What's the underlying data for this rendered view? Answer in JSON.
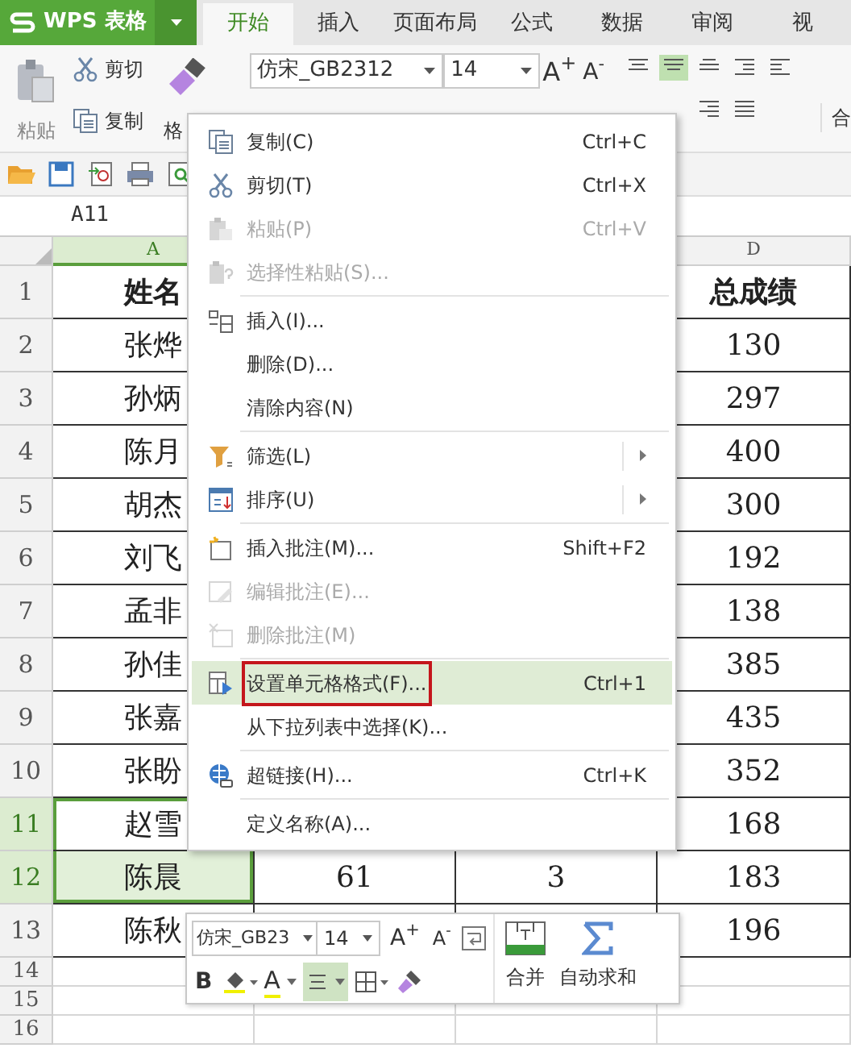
{
  "app": {
    "title": "WPS 表格"
  },
  "tabs": [
    {
      "label": "开始",
      "selected": true
    },
    {
      "label": "插入",
      "selected": false
    },
    {
      "label": "页面布局",
      "selected": false
    },
    {
      "label": "公式",
      "selected": false
    },
    {
      "label": "数据",
      "selected": false
    },
    {
      "label": "审阅",
      "selected": false
    },
    {
      "label": "视",
      "selected": false
    }
  ],
  "ribbon": {
    "paste": "粘贴",
    "cut": "剪切",
    "copy": "复制",
    "format_painter": "格",
    "font": "仿宋_GB2312",
    "size": "14",
    "grow": "A$^{+}$",
    "shrink": "A$^{-}$",
    "merge": "合"
  },
  "name_box": "A11",
  "columns": [
    {
      "label": "A",
      "selected": true
    },
    {},
    {},
    {
      "label": "D",
      "selected": false
    }
  ],
  "rows": [
    {
      "number": "1",
      "kind": "header",
      "selected": false,
      "active": false,
      "cells": [
        "姓名",
        null,
        null,
        "总成绩"
      ]
    },
    {
      "number": "2",
      "kind": "data",
      "selected": false,
      "active": false,
      "cells": [
        "张烨",
        null,
        null,
        "130"
      ]
    },
    {
      "number": "3",
      "kind": "data",
      "selected": false,
      "active": false,
      "cells": [
        "孙炳",
        null,
        null,
        "297"
      ]
    },
    {
      "number": "4",
      "kind": "data",
      "selected": false,
      "active": false,
      "cells": [
        "陈月",
        null,
        null,
        "400"
      ]
    },
    {
      "number": "5",
      "kind": "data",
      "selected": false,
      "active": false,
      "cells": [
        "胡杰",
        null,
        null,
        "300"
      ]
    },
    {
      "number": "6",
      "kind": "data",
      "selected": false,
      "active": false,
      "cells": [
        "刘飞",
        null,
        null,
        "192"
      ]
    },
    {
      "number": "7",
      "kind": "data",
      "selected": false,
      "active": false,
      "cells": [
        "孟非",
        null,
        null,
        "138"
      ]
    },
    {
      "number": "8",
      "kind": "data",
      "selected": false,
      "active": false,
      "cells": [
        "孙佳",
        null,
        null,
        "385"
      ]
    },
    {
      "number": "9",
      "kind": "data",
      "selected": false,
      "active": false,
      "cells": [
        "张嘉",
        null,
        null,
        "435"
      ]
    },
    {
      "number": "10",
      "kind": "data",
      "selected": false,
      "active": false,
      "cells": [
        "张盼",
        null,
        null,
        "352"
      ]
    },
    {
      "number": "11",
      "kind": "data",
      "selected": true,
      "active": true,
      "cells": [
        "赵雪",
        null,
        null,
        "168"
      ]
    },
    {
      "number": "12",
      "kind": "data",
      "selected": true,
      "active": false,
      "cells": [
        "陈晨",
        "61",
        "3",
        "183"
      ]
    },
    {
      "number": "13",
      "kind": "data",
      "selected": false,
      "active": false,
      "cells": [
        "陈秋",
        null,
        null,
        "196"
      ]
    },
    {
      "number": "14",
      "kind": "empty",
      "selected": false,
      "active": false,
      "cells": [
        null,
        null,
        null,
        null
      ]
    },
    {
      "number": "15",
      "kind": "empty",
      "selected": false,
      "active": false,
      "cells": [
        null,
        null,
        null,
        null
      ]
    },
    {
      "number": "16",
      "kind": "empty",
      "selected": false,
      "active": false,
      "cells": [
        null,
        null,
        null,
        null
      ]
    }
  ],
  "context_menu": [
    {
      "kind": "item",
      "label": "复制(C)",
      "shortcut": "Ctrl+C",
      "disabled": false,
      "submenu": false,
      "highlighted": false,
      "outlined": false
    },
    {
      "kind": "item",
      "label": "剪切(T)",
      "shortcut": "Ctrl+X",
      "disabled": false,
      "submenu": false,
      "highlighted": false,
      "outlined": false
    },
    {
      "kind": "item",
      "label": "粘贴(P)",
      "shortcut": "Ctrl+V",
      "disabled": true,
      "submenu": false,
      "highlighted": false,
      "outlined": false
    },
    {
      "kind": "item",
      "label": "选择性粘贴(S)...",
      "disabled": true,
      "submenu": false,
      "highlighted": false,
      "outlined": false
    },
    {
      "kind": "separator"
    },
    {
      "kind": "item",
      "label": "插入(I)...",
      "disabled": false,
      "submenu": false,
      "highlighted": false,
      "outlined": false
    },
    {
      "kind": "item",
      "label": "删除(D)...",
      "disabled": false,
      "submenu": false,
      "highlighted": false,
      "outlined": false
    },
    {
      "kind": "item",
      "label": "清除内容(N)",
      "disabled": false,
      "submenu": false,
      "highlighted": false,
      "outlined": false
    },
    {
      "kind": "separator"
    },
    {
      "kind": "item",
      "label": "筛选(L)",
      "disabled": false,
      "submenu": true,
      "highlighted": false,
      "outlined": false
    },
    {
      "kind": "item",
      "label": "排序(U)",
      "disabled": false,
      "submenu": true,
      "highlighted": false,
      "outlined": false
    },
    {
      "kind": "separator"
    },
    {
      "kind": "item",
      "label": "插入批注(M)...",
      "shortcut": "Shift+F2",
      "disabled": false,
      "submenu": false,
      "highlighted": false,
      "outlined": false
    },
    {
      "kind": "item",
      "label": "编辑批注(E)...",
      "disabled": true,
      "submenu": false,
      "highlighted": false,
      "outlined": false
    },
    {
      "kind": "item",
      "label": "删除批注(M)",
      "disabled": true,
      "submenu": false,
      "highlighted": false,
      "outlined": false
    },
    {
      "kind": "separator"
    },
    {
      "kind": "item",
      "label": "设置单元格格式(F)...",
      "shortcut": "Ctrl+1",
      "disabled": false,
      "submenu": false,
      "highlighted": true,
      "outlined": true
    },
    {
      "kind": "item",
      "label": "从下拉列表中选择(K)...",
      "disabled": false,
      "submenu": false,
      "highlighted": false,
      "outlined": false
    },
    {
      "kind": "separator"
    },
    {
      "kind": "item",
      "label": "超链接(H)...",
      "shortcut": "Ctrl+K",
      "disabled": false,
      "submenu": false,
      "highlighted": false,
      "outlined": false
    },
    {
      "kind": "separator"
    },
    {
      "kind": "item",
      "label": "定义名称(A)...",
      "disabled": false,
      "submenu": false,
      "highlighted": false,
      "outlined": false
    }
  ],
  "mini_toolbar": {
    "font": "仿宋_GB23",
    "size": "14",
    "grow": "A$^{+}$",
    "shrink": "A$^{-}$",
    "bold": "B",
    "font_color": "A",
    "align_selected": true,
    "merge": "合并",
    "autosum": "自动求和"
  }
}
